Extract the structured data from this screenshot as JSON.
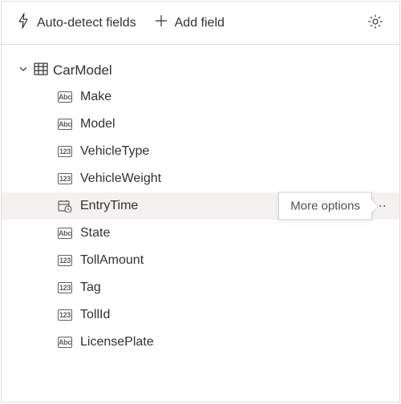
{
  "toolbar": {
    "autodetect_label": "Auto-detect fields",
    "addfield_label": "Add field"
  },
  "tooltip": {
    "more_options": "More options"
  },
  "tree": {
    "root_label": "CarModel",
    "fields": [
      {
        "label": "Make",
        "type": "Abc"
      },
      {
        "label": "Model",
        "type": "Abc"
      },
      {
        "label": "VehicleType",
        "type": "123"
      },
      {
        "label": "VehicleWeight",
        "type": "123"
      },
      {
        "label": "EntryTime",
        "type": "date",
        "hover": true
      },
      {
        "label": "State",
        "type": "Abc"
      },
      {
        "label": "TollAmount",
        "type": "123"
      },
      {
        "label": "Tag",
        "type": "123"
      },
      {
        "label": "TollId",
        "type": "123"
      },
      {
        "label": "LicensePlate",
        "type": "Abc"
      }
    ]
  }
}
